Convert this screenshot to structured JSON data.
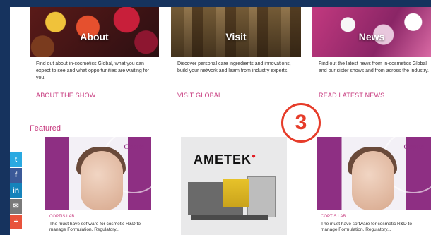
{
  "tiles": [
    {
      "caption": "About",
      "description": "Find out about in-cosmetics Global, what you can expect to see and what opportunities are waiting for you.",
      "link": "ABOUT THE SHOW"
    },
    {
      "caption": "Visit",
      "description": "Discover personal care ingredients and innovations, build your network and learn from industry experts.",
      "link": "VISIT GLOBAL"
    },
    {
      "caption": "News",
      "description": "Find out the latest news from in-cosmetics Global and our sister shows and from across the industry.",
      "link": "READ LATEST NEWS"
    }
  ],
  "featured": {
    "label": "Featured",
    "step_number": "3",
    "cards": [
      {
        "brand": "Coptis",
        "tag": "COPTIS LAB",
        "text": "The must have software for cosmetic R&D to manage Formulation, Regulatory..."
      },
      {
        "brand": "AMETEK"
      },
      {
        "brand": "Coptis",
        "tag": "COPTIS LAB",
        "text": "The must have software for cosmetic R&D to manage Formulation, Regulatory..."
      }
    ]
  },
  "social": {
    "twitter": "t",
    "facebook": "f",
    "linkedin": "in",
    "email": "✉",
    "plus": "+"
  },
  "colors": {
    "accent_pink": "#c7397e",
    "badge_red": "#e63c2a",
    "page_background": "#16335e"
  }
}
